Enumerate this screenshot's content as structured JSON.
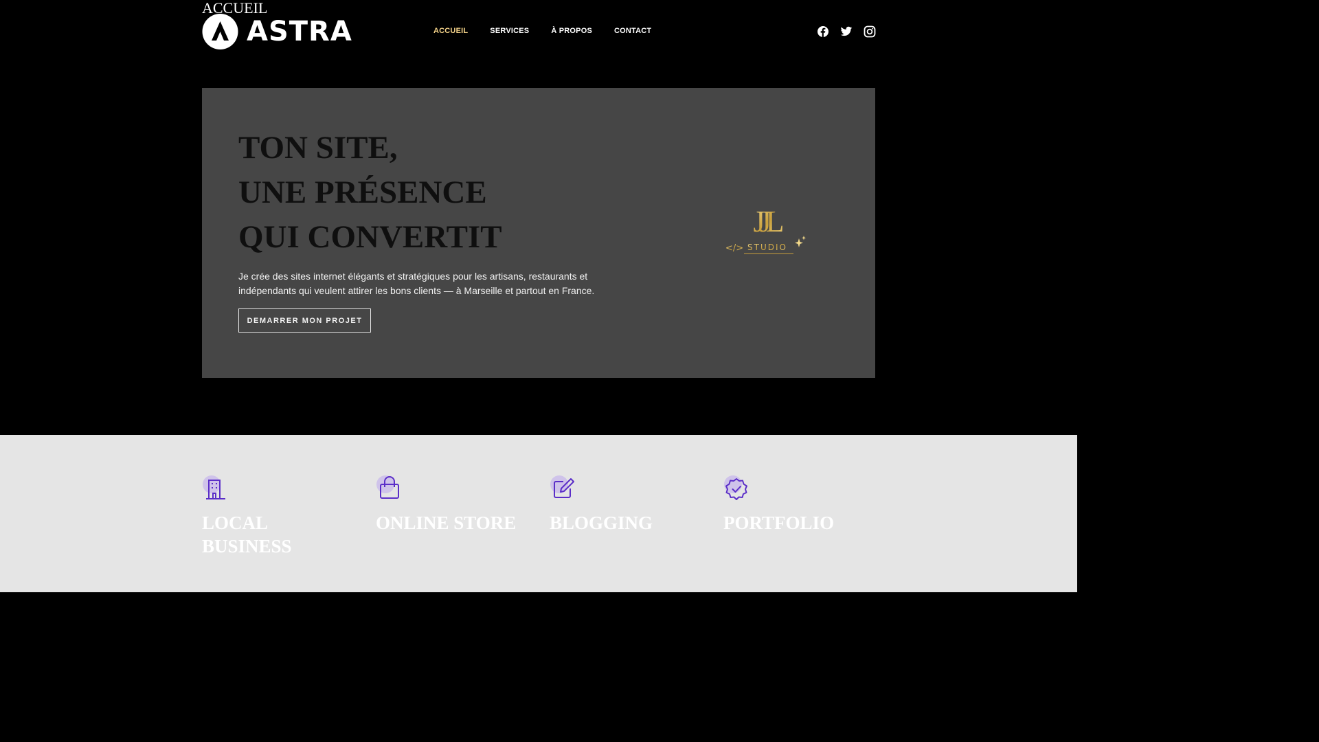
{
  "site": {
    "title": "ACCUEIL",
    "brand": "ASTRA"
  },
  "nav": {
    "items": [
      {
        "label": "ACCUEIL",
        "active": true
      },
      {
        "label": "SERVICES",
        "active": false
      },
      {
        "label": "À PROPOS",
        "active": false
      },
      {
        "label": "CONTACT",
        "active": false
      }
    ]
  },
  "social": {
    "icons": [
      "facebook-icon",
      "twitter-icon",
      "instagram-icon"
    ]
  },
  "hero": {
    "heading_lines": [
      "TON SITE,",
      "UNE PRÉSENCE",
      "QUI CONVERTIT"
    ],
    "text": "Je crée des sites internet élégants et stratégiques pour les artisans, restaurants et indépendants qui veulent attirer les bons clients — à Marseille et partout en France.",
    "cta_label": "DEMARRER MON PROJET",
    "logo_monogram": "JJL",
    "logo_code": "</>",
    "logo_label": "STUDIO"
  },
  "features": [
    {
      "title": "LOCAL BUSINESS",
      "icon": "building-icon"
    },
    {
      "title": "ONLINE STORE",
      "icon": "shopping-bag-icon"
    },
    {
      "title": "BLOGGING",
      "icon": "edit-icon"
    },
    {
      "title": "PORTFOLIO",
      "icon": "badge-check-icon"
    }
  ],
  "colors": {
    "background": "#000000",
    "accent": "#f6d48a",
    "hero_panel": "#464646",
    "features_band": "#e5e5e5",
    "icon_purple": "#5b2ec8",
    "gold": "#d4ac4a"
  }
}
